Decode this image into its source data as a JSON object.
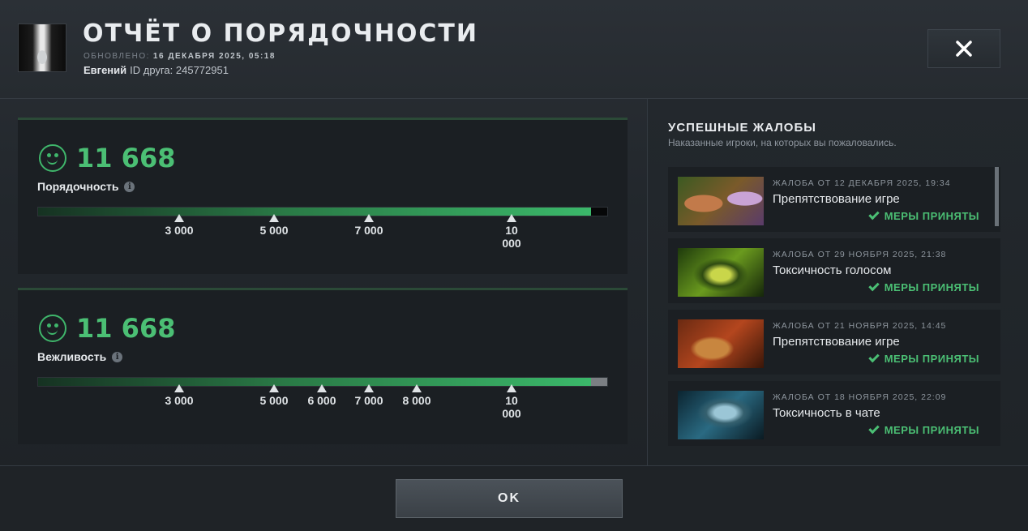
{
  "header": {
    "title": "ОТЧЁТ О ПОРЯДОЧНОСТИ",
    "updated_label": "ОБНОВЛЕНО:",
    "updated_value": "16 ДЕКАБРЯ 2025, 05:18",
    "user_name": "Евгений",
    "friend_id_label": "ID друга:",
    "friend_id": "245772951",
    "close_icon": "close-icon"
  },
  "conduct": {
    "score": "11 668",
    "label": "Порядочность",
    "fill_fraction": 0.971,
    "ticks": [
      "3 000",
      "5 000",
      "7 000",
      "10 000"
    ]
  },
  "courtesy": {
    "score": "11 668",
    "label": "Вежливость",
    "fill_fraction": 0.971,
    "ticks": [
      "3 000",
      "5 000",
      "6 000",
      "7 000",
      "8 000",
      "10 000"
    ]
  },
  "reports": {
    "title": "УСПЕШНЫЕ ЖАЛОБЫ",
    "subtitle": "Наказанные игроки, на которых вы пожаловались.",
    "items": [
      {
        "meta": "ЖАЛОБА ОТ 12 ДЕКАБРЯ 2025, 19:34",
        "reason": "Препятствование игре",
        "status": "МЕРЫ ПРИНЯТЫ"
      },
      {
        "meta": "ЖАЛОБА ОТ 29 НОЯБРЯ 2025, 21:38",
        "reason": "Токсичность голосом",
        "status": "МЕРЫ ПРИНЯТЫ"
      },
      {
        "meta": "ЖАЛОБА ОТ 21 НОЯБРЯ 2025, 14:45",
        "reason": "Препятствование игре",
        "status": "МЕРЫ ПРИНЯТЫ"
      },
      {
        "meta": "ЖАЛОБА ОТ 18 НОЯБРЯ 2025, 22:09",
        "reason": "Токсичность в чате",
        "status": "МЕРЫ ПРИНЯТЫ"
      }
    ]
  },
  "footer": {
    "ok_label": "OK"
  },
  "colors": {
    "accent_green": "#4bbf74",
    "panel_bg": "#1b1f23"
  }
}
